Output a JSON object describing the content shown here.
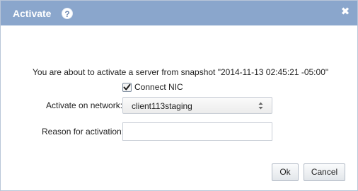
{
  "dialog": {
    "title": "Activate",
    "help_glyph": "?",
    "close_glyph": "✖"
  },
  "message": "You are about to activate a server from snapshot \"2014-11-13 02:45:21 -05:00\"",
  "connect_nic": {
    "label": "Connect NIC",
    "checked": true
  },
  "network": {
    "label": "Activate on network:",
    "selected": "client113staging"
  },
  "reason": {
    "label": "Reason for activation:",
    "value": ""
  },
  "buttons": {
    "ok": "Ok",
    "cancel": "Cancel"
  },
  "colors": {
    "titlebar": "#8aa6cc",
    "border": "#b9c6d8"
  }
}
